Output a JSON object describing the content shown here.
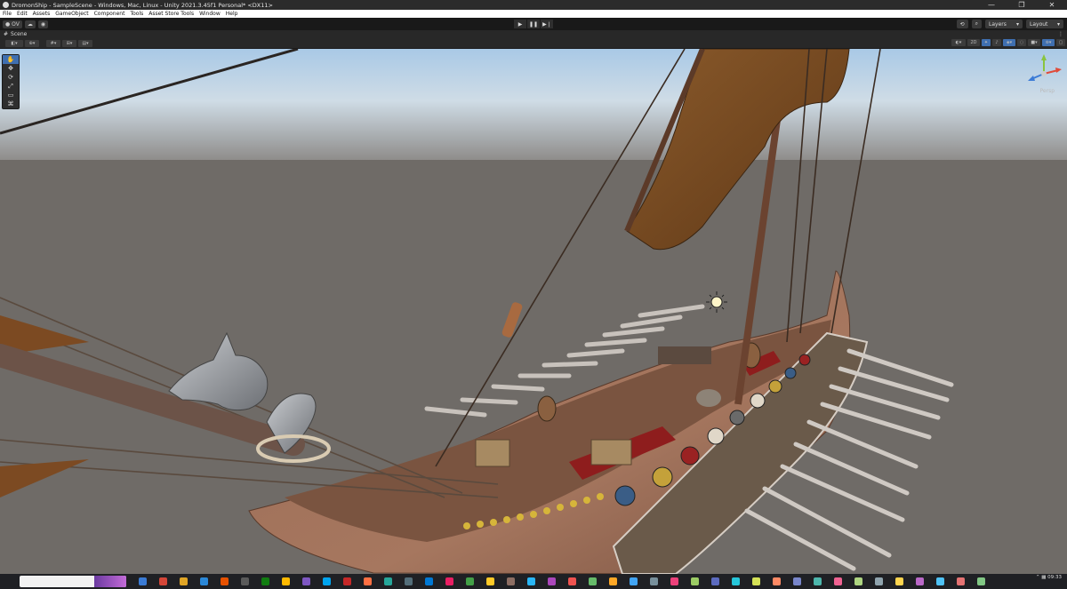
{
  "window": {
    "title": "DromonShip - SampleScene - Windows, Mac, Linux - Unity 2021.3.45f1 Personal* <DX11>",
    "minimize": "—",
    "maximize": "❐",
    "close": "✕"
  },
  "menu": [
    "File",
    "Edit",
    "Assets",
    "GameObject",
    "Component",
    "Tools",
    "Asset Store Tools",
    "Window",
    "Help"
  ],
  "toolbar": {
    "account": "OV",
    "layers": "Layers",
    "layout": "Layout",
    "search_icon": "search-icon",
    "history_icon": "history-icon",
    "play_icons": [
      "play-icon",
      "pause-icon",
      "step-icon"
    ]
  },
  "scene_tab": {
    "label": "Scene"
  },
  "scene_view": {
    "gizmo_label": "Persp",
    "accent_color": "#3f6fb0",
    "sky_top": "#bcd6ee",
    "ground": "#6e6a65"
  },
  "taskbar": {
    "time": "09:33",
    "icon_colors": [
      "#3a7bd5",
      "#d44638",
      "#e0a526",
      "#2b88d8",
      "#e65100",
      "#5a5a5a",
      "#107c10",
      "#ffb900",
      "#7e57c2",
      "#00a4ef",
      "#c62828",
      "#ff7043",
      "#26a69a",
      "#546e7a",
      "#0078d4",
      "#e91e63",
      "#43a047",
      "#ffca28",
      "#8d6e63",
      "#29b6f6",
      "#ab47bc",
      "#ef5350",
      "#66bb6a",
      "#ffa726",
      "#42a5f5",
      "#78909c",
      "#ec407a",
      "#9ccc65",
      "#5c6bc0",
      "#26c6da",
      "#d4e157",
      "#ff8a65",
      "#7986cb",
      "#4db6ac",
      "#f06292",
      "#aed581",
      "#90a4ae",
      "#ffd54f",
      "#ba68c8",
      "#4fc3f7",
      "#e57373",
      "#81c784"
    ]
  }
}
